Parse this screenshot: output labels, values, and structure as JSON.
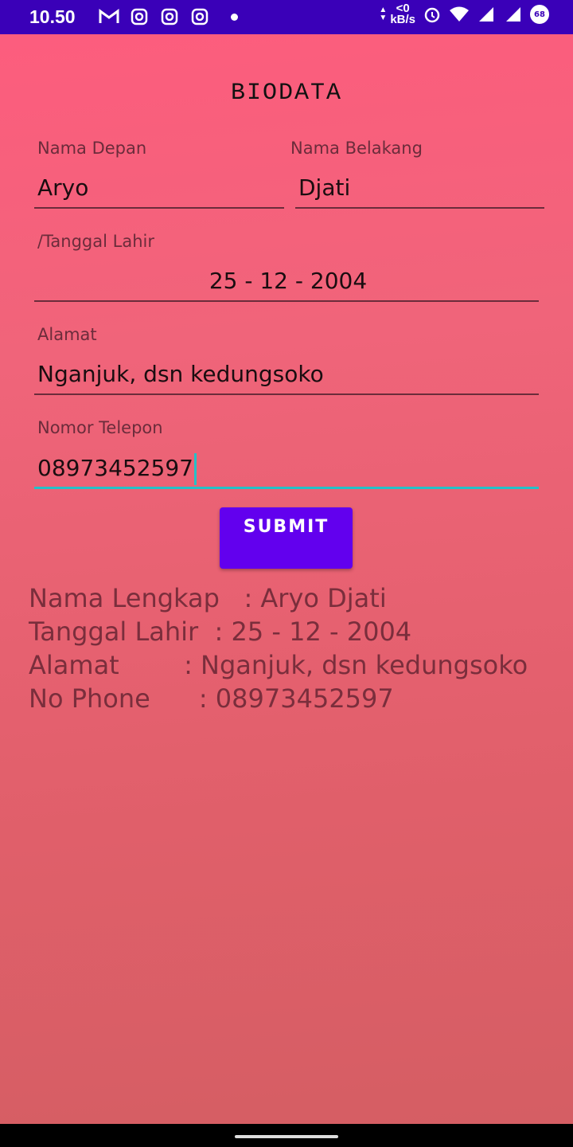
{
  "status_bar": {
    "time": "10.50",
    "icons_left": [
      "gmail-icon",
      "instagram-icon",
      "instagram-icon",
      "instagram-icon",
      "notification-dot-icon"
    ],
    "speed_value": "<0",
    "speed_unit": "kB/s",
    "battery": "68"
  },
  "title": "BIODATA",
  "form": {
    "first_name_label": "Nama Depan",
    "first_name_value": "Aryo",
    "last_name_label": "Nama Belakang",
    "last_name_value": "Djati",
    "birth_label": "/Tanggal Lahir",
    "birth_value": "25 - 12 - 2004",
    "address_label": "Alamat",
    "address_value": "Nganjuk, dsn kedungsoko",
    "phone_label": "Nomor Telepon",
    "phone_value": "08973452597",
    "submit_label": "SUBMIT"
  },
  "result": {
    "line1": "Nama Lengkap   : Aryo Djati",
    "line2": "Tanggal Lahir  : 25 - 12 - 2004",
    "line3": "Alamat        : Nganjuk, dsn kedungsoko",
    "line4": "No Phone      : 08973452597"
  },
  "colors": {
    "status_bar": "#3a00b8",
    "button": "#6200ee",
    "focus_accent": "#24c1c8"
  }
}
